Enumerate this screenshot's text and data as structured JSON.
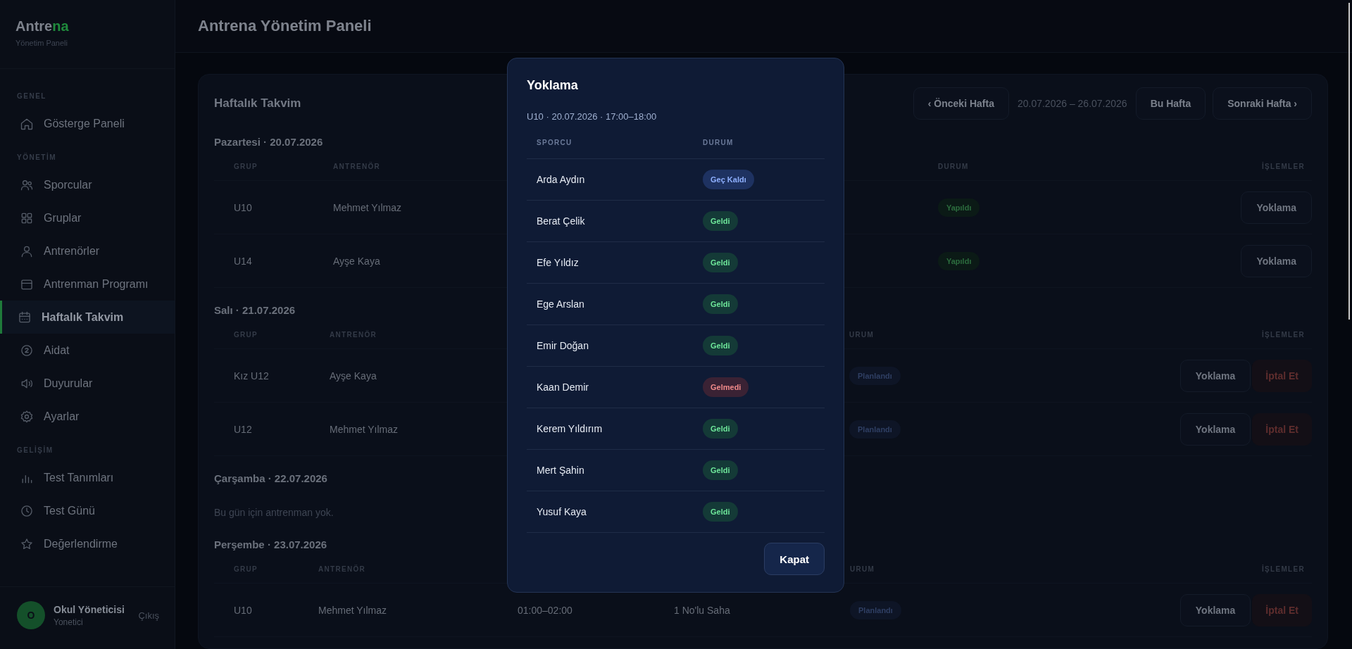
{
  "sidebar": {
    "brand": {
      "prefix": "Antre",
      "accent": "na"
    },
    "subtitle": "Yönetim Paneli",
    "sections": [
      {
        "title": "GENEL",
        "items": [
          {
            "label": "Gösterge Paneli",
            "selected": false
          }
        ]
      },
      {
        "title": "YÖNETİM",
        "items": [
          {
            "label": "Sporcular",
            "selected": false
          },
          {
            "label": "Gruplar",
            "selected": false
          },
          {
            "label": "Antrenörler",
            "selected": false
          },
          {
            "label": "Antrenman Programı",
            "selected": false
          },
          {
            "label": "Haftalık Takvim",
            "selected": true
          },
          {
            "label": "Aidat",
            "selected": false
          },
          {
            "label": "Duyurular",
            "selected": false
          },
          {
            "label": "Ayarlar",
            "selected": false
          }
        ]
      },
      {
        "title": "GELİŞİM",
        "items": [
          {
            "label": "Test Tanımları",
            "selected": false
          },
          {
            "label": "Test Günü",
            "selected": false
          },
          {
            "label": "Değerlendirme",
            "selected": false
          }
        ]
      }
    ],
    "user": {
      "avatar": "O",
      "name": "Okul Yöneticisi",
      "role": "Yonetici",
      "logout": "Çıkış"
    }
  },
  "header": {
    "title": "Antrena Yönetim Paneli"
  },
  "calendar": {
    "title": "Haftalık Takvim",
    "prev": "‹ Önceki Hafta",
    "range": "20.07.2026 – 26.07.2026",
    "current": "Bu Hafta",
    "next": "Sonraki Hafta ›",
    "days": [
      {
        "heading": "Pazartesi · 20.07.2026",
        "columns": {
          "group": "GRUP",
          "coach": "ANTRENÖR",
          "status": "DURUM",
          "actions": "İŞLEMLER"
        },
        "sessions": [
          {
            "group": "U10",
            "coach": "Mehmet Yılmaz",
            "status": {
              "kind": "done",
              "label": "Yapıldı"
            },
            "actions": [
              {
                "kind": "attendance",
                "label": "Yoklama"
              }
            ]
          },
          {
            "group": "U14",
            "coach": "Ayşe Kaya",
            "status": {
              "kind": "done",
              "label": "Yapıldı"
            },
            "actions": [
              {
                "kind": "attendance",
                "label": "Yoklama"
              }
            ]
          }
        ]
      },
      {
        "heading": "Salı · 21.07.2026",
        "columns": {
          "group": "GRUP",
          "coach": "ANTRENÖR",
          "status": "URUM",
          "actions": "İŞLEMLER"
        },
        "sessions": [
          {
            "group": "Kız U12",
            "coach": "Ayşe Kaya",
            "status": {
              "kind": "planned",
              "label": "Planlandı"
            },
            "actions": [
              {
                "kind": "attendance",
                "label": "Yoklama"
              },
              {
                "kind": "cancel",
                "label": "İptal Et"
              }
            ]
          },
          {
            "group": "U12",
            "coach": "Mehmet Yılmaz",
            "status": {
              "kind": "planned",
              "label": "Planlandı"
            },
            "actions": [
              {
                "kind": "attendance",
                "label": "Yoklama"
              },
              {
                "kind": "cancel",
                "label": "İptal Et"
              }
            ]
          }
        ]
      },
      {
        "heading": "Çarşamba · 22.07.2026",
        "empty": "Bu gün için antrenman yok."
      },
      {
        "heading": "Perşembe · 23.07.2026",
        "columns": {
          "group": "GRUP",
          "coach": "ANTRENÖR",
          "status": "URUM",
          "actions": "İŞLEMLER"
        },
        "sessions": [
          {
            "group": "U10",
            "coach": "Mehmet Yılmaz",
            "time": "01:00–02:00",
            "place": "1 No'lu Saha",
            "status": {
              "kind": "planned",
              "label": "Planlandı"
            },
            "actions": [
              {
                "kind": "attendance",
                "label": "Yoklama"
              },
              {
                "kind": "cancel",
                "label": "İptal Et"
              }
            ]
          }
        ]
      }
    ]
  },
  "modal": {
    "title": "Yoklama",
    "subtitle": "U10 · 20.07.2026 · 17:00–18:00",
    "columns": {
      "athlete": "SPORCU",
      "status": "DURUM"
    },
    "rows": [
      {
        "name": "Arda Aydın",
        "status": {
          "kind": "late",
          "label": "Geç Kaldı"
        }
      },
      {
        "name": "Berat Çelik",
        "status": {
          "kind": "present",
          "label": "Geldi"
        }
      },
      {
        "name": "Efe Yıldız",
        "status": {
          "kind": "present",
          "label": "Geldi"
        }
      },
      {
        "name": "Ege Arslan",
        "status": {
          "kind": "present",
          "label": "Geldi"
        }
      },
      {
        "name": "Emir Doğan",
        "status": {
          "kind": "present",
          "label": "Geldi"
        }
      },
      {
        "name": "Kaan Demir",
        "status": {
          "kind": "absent",
          "label": "Gelmedi"
        }
      },
      {
        "name": "Kerem Yıldırım",
        "status": {
          "kind": "present",
          "label": "Geldi"
        }
      },
      {
        "name": "Mert Şahin",
        "status": {
          "kind": "present",
          "label": "Geldi"
        }
      },
      {
        "name": "Yusuf Kaya",
        "status": {
          "kind": "present",
          "label": "Geldi"
        }
      }
    ],
    "close": "Kapat"
  }
}
